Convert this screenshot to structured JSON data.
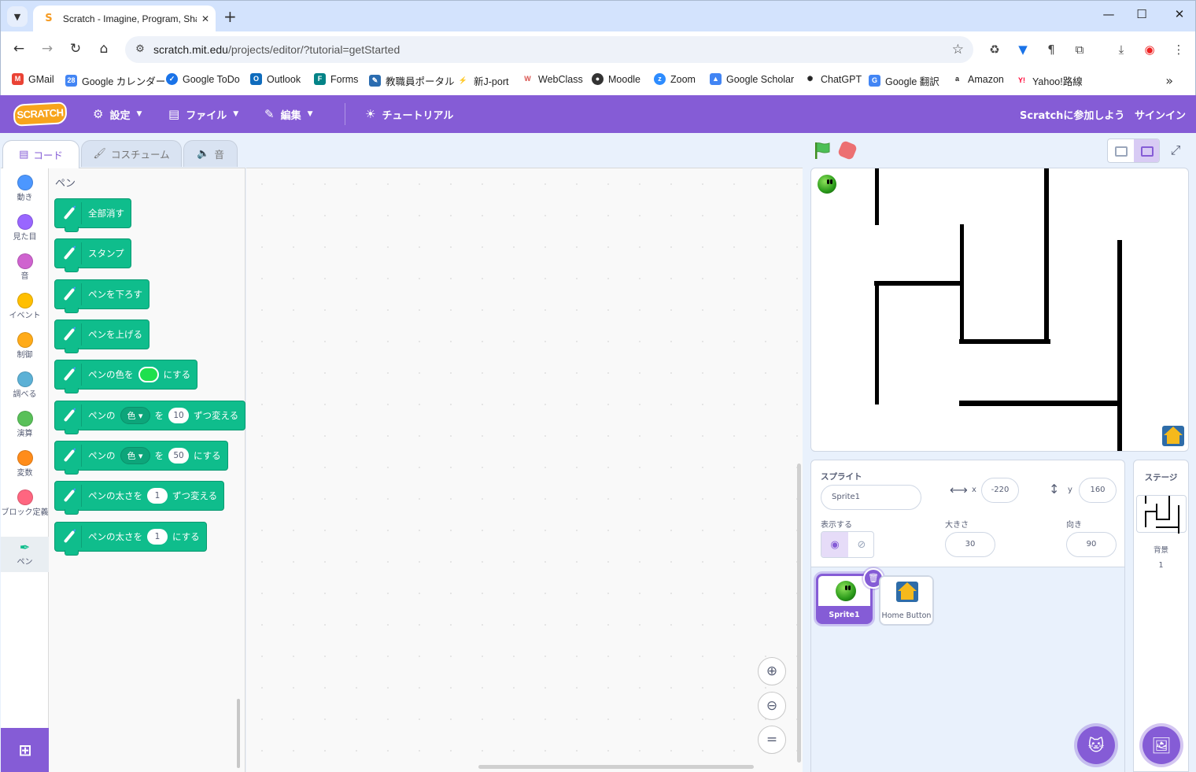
{
  "browser": {
    "tab_title": "Scratch - Imagine, Program, Sha",
    "tab_favicon": "S",
    "url_host": "scratch.mit.edu",
    "url_path": "/projects/editor/?tutorial=getStarted",
    "bookmarks": [
      {
        "label": "GMail",
        "icon": "gmail-icon",
        "color": "#ea4335"
      },
      {
        "label": "Google カレンダー",
        "icon": "calendar-icon",
        "color": "#4285f4"
      },
      {
        "label": "Google ToDo",
        "icon": "tasks-icon",
        "color": "#1a73e8"
      },
      {
        "label": "Outlook",
        "icon": "outlook-icon",
        "color": "#0f6cbd"
      },
      {
        "label": "Forms",
        "icon": "forms-icon",
        "color": "#038387"
      },
      {
        "label": "教職員ポータル",
        "icon": "portal-icon",
        "color": "#2b6cb0"
      },
      {
        "label": "新J-port",
        "icon": "jport-icon",
        "color": "#1e88e5"
      },
      {
        "label": "WebClass",
        "icon": "webclass-icon",
        "color": "#d9534f"
      },
      {
        "label": "Moodle",
        "icon": "moodle-icon",
        "color": "#333333"
      },
      {
        "label": "Zoom",
        "icon": "zoom-icon",
        "color": "#2d8cff"
      },
      {
        "label": "Google Scholar",
        "icon": "scholar-icon",
        "color": "#4285f4"
      },
      {
        "label": "ChatGPT",
        "icon": "chatgpt-icon",
        "color": "#222222"
      },
      {
        "label": "Google 翻訳",
        "icon": "translate-icon",
        "color": "#4285f4"
      },
      {
        "label": "Amazon",
        "icon": "amazon-icon",
        "color": "#222222"
      },
      {
        "label": "Yahoo!路線",
        "icon": "yahoo-icon",
        "color": "#ff0033"
      }
    ]
  },
  "menubar": {
    "logo": "SCRATCH",
    "settings": "設定",
    "file": "ファイル",
    "edit": "編集",
    "tutorials": "チュートリアル",
    "join": "Scratchに参加しよう",
    "signin": "サインイン"
  },
  "editor_tabs": {
    "code": "コード",
    "costumes": "コスチューム",
    "sounds": "音"
  },
  "categories": [
    {
      "label": "動き",
      "color": "#4c97ff"
    },
    {
      "label": "見た目",
      "color": "#9966ff"
    },
    {
      "label": "音",
      "color": "#cf63cf"
    },
    {
      "label": "イベント",
      "color": "#ffbf00"
    },
    {
      "label": "制御",
      "color": "#ffab19"
    },
    {
      "label": "調べる",
      "color": "#5cb1d6"
    },
    {
      "label": "演算",
      "color": "#59c059"
    },
    {
      "label": "変数",
      "color": "#ff8c1a"
    },
    {
      "label": "ブロック定義",
      "color": "#ff6680"
    },
    {
      "label": "ペン",
      "color": "#0fbd8c"
    }
  ],
  "palette": {
    "heading": "ペン",
    "blocks": {
      "clear": "全部消す",
      "stamp": "スタンプ",
      "pen_down": "ペンを下ろす",
      "pen_up": "ペンを上げる",
      "set_color_a": "ペンの色を",
      "set_color_b": "にする",
      "change_param_a": "ペンの",
      "change_param_dd": "色",
      "change_param_b": "を",
      "change_param_val": "10",
      "change_param_c": "ずつ変える",
      "set_param_a": "ペンの",
      "set_param_dd": "色",
      "set_param_b": "を",
      "set_param_val": "50",
      "set_param_c": "にする",
      "change_size_a": "ペンの太さを",
      "change_size_val": "1",
      "change_size_b": "ずつ変える",
      "set_size_a": "ペンの太さを",
      "set_size_val": "1",
      "set_size_b": "にする"
    }
  },
  "sprite_info": {
    "sprite_label": "スプライト",
    "sprite_name": "Sprite1",
    "x_label": "x",
    "x_value": "-220",
    "y_label": "y",
    "y_value": "160",
    "show_label": "表示する",
    "size_label": "大きさ",
    "size_value": "30",
    "direction_label": "向き",
    "direction_value": "90"
  },
  "sprites": [
    {
      "name": "Sprite1",
      "selected": true
    },
    {
      "name": "Home Button",
      "selected": false
    }
  ],
  "stage_pane": {
    "title": "ステージ",
    "backdrop_label": "背景",
    "backdrop_count": "1"
  }
}
